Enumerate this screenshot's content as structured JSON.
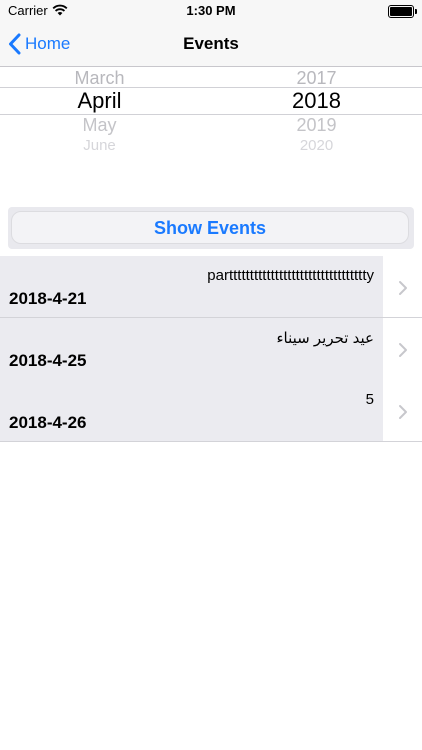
{
  "status_bar": {
    "carrier": "Carrier",
    "time": "1:30 PM",
    "icons": [
      "wifi-icon",
      "battery-icon"
    ]
  },
  "nav_bar": {
    "back_label": "Home",
    "title": "Events",
    "icons": [
      "chevron-left-icon"
    ]
  },
  "picker": {
    "months": [
      "March",
      "April",
      "May",
      "June"
    ],
    "years": [
      "2017",
      "2018",
      "2019",
      "2020"
    ],
    "selected_month": "April",
    "selected_year": "2018"
  },
  "show_button": {
    "label": "Show Events"
  },
  "events": [
    {
      "title": "parttttttttttttttttttttttttttttttttty",
      "date": "2018-4-21"
    },
    {
      "title": "عيد تحرير سيناء",
      "date": "2018-4-25"
    },
    {
      "title": "5",
      "date": "2018-4-26"
    }
  ],
  "colors": {
    "accent": "#1a7aff",
    "cell_background": "#ebebf0",
    "separator": "#d3d3d8"
  }
}
